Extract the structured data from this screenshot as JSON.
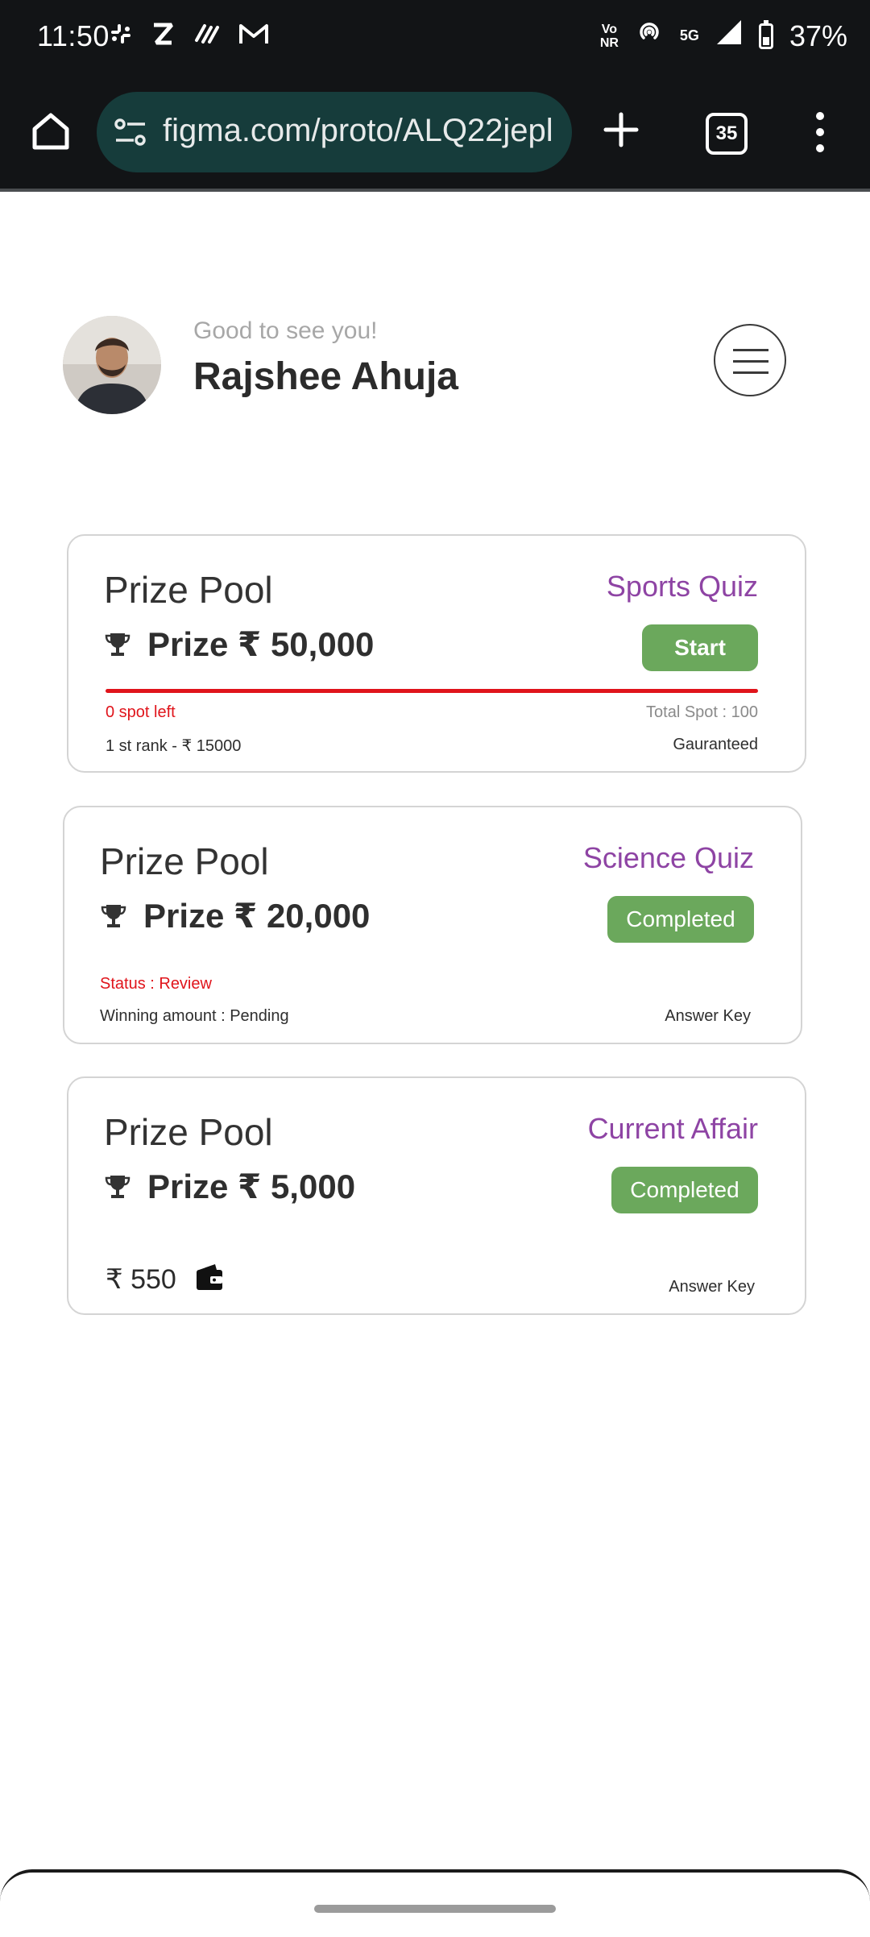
{
  "status_bar": {
    "time": "11:50",
    "app_icons": [
      "slack-icon",
      "zomato-icon",
      "payments-icon",
      "gmail-icon"
    ],
    "volte_top": "Vo",
    "volte_bottom": "NR",
    "network": "5G",
    "battery": "37%"
  },
  "browser": {
    "url": "figma.com/proto/ALQ22jepl",
    "tab_count": "35"
  },
  "header": {
    "greeting": "Good to see you!",
    "user_name": "Rajshee Ahuja"
  },
  "cards": [
    {
      "title": "Prize Pool",
      "category": "Sports Quiz",
      "prize": "Prize ₹ 50,000",
      "button": "Start",
      "spots_left": "0 spot left",
      "total_spot": "Total Spot : 100",
      "first_rank": "1 st rank - ₹ 15000",
      "guarantee": "Gauranteed",
      "progress_fraction": 1.0
    },
    {
      "title": "Prize Pool",
      "category": "Science Quiz",
      "prize": "Prize ₹ 20,000",
      "button": "Completed",
      "status": "Status : Review",
      "winning": "Winning amount : Pending",
      "answer_key": "Answer Key"
    },
    {
      "title": "Prize Pool",
      "category": "Current Affair",
      "prize": "Prize ₹ 5,000",
      "button": "Completed",
      "winning_amount": "₹ 550",
      "answer_key": "Answer Key"
    }
  ],
  "colors": {
    "accent_purple": "#8e44a4",
    "button_green": "#6ba85c",
    "alert_red": "#e0141b"
  }
}
